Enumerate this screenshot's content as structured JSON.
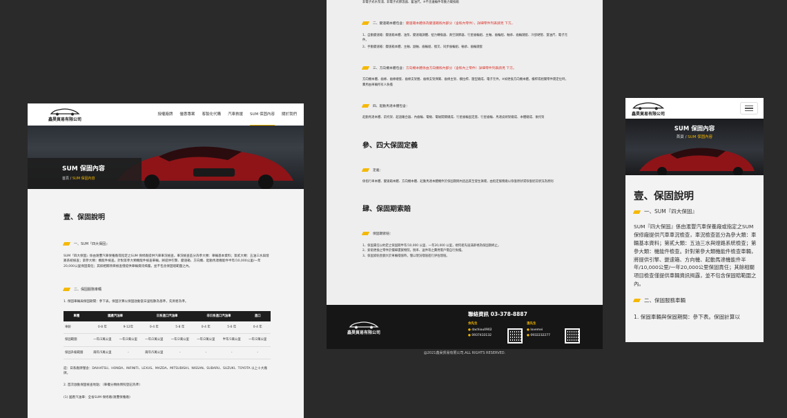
{
  "brand": {
    "logo_text": "鑫昊貿易有限公司"
  },
  "nav": {
    "items": [
      "授權廠牌",
      "優惠專案",
      "客製化代購",
      "汽車救援",
      "SUM 保固內容",
      "關於我們"
    ],
    "active_index": 4
  },
  "hero": {
    "title": "SUM 保固內容",
    "crumb_home": "首頁",
    "crumb_sep": "/",
    "crumb_current": "SUM 保固內容"
  },
  "section1": {
    "title": "壹、保固說明",
    "sub1": "一、SUM『四大保固』",
    "para1": "SUM『四大保固』係由滙豐汽車保養廠或指定之SUM 保修廠提供汽車車況檢查，車況檢查區分為參大類：車輛基本資料；第貳大類：五油三水與燈路系統檢查；第參大類：機能件檢查。針對第參大類機能件檢查車輛，將提供引擎、變速箱、方向機、起動馬達機能件半年/10,000公里/一年20,000公里保固責任；其餘相關項目檢查僅提供車輛資訊揭露，並不包含保固賠範圍之內。",
    "sub2": "二、保固服務車輛",
    "para2": "1. 保固車輛與保固期間：參下表。保固計算以保固啟動當日里程數為基準，先到者為準。"
  },
  "table": {
    "headers": [
      "車種",
      "國產汽油車",
      "日系進口汽油車",
      "非日系進口汽油車",
      "進口"
    ],
    "subheaders": [
      "",
      "",
      "",
      "",
      ""
    ],
    "rows": [
      [
        "車齡",
        "0-8 年",
        "9-12年",
        "0-4 年",
        "5-8 年",
        "0-4 年",
        "5-6 年",
        "0-4 年"
      ],
      [
        "保固範圍",
        "一年/2萬公里",
        "一年/2萬公里",
        "一年/2萬公里",
        "一年/2萬公里",
        "一年/2萬公里",
        "半年/1萬公里",
        "一年/2萬公里"
      ],
      [
        "保固升級範圍",
        "兩年/5萬公里",
        "-",
        "兩年/5萬公里",
        "-",
        "-",
        "-",
        "-"
      ]
    ],
    "note": "註：日系廠牌僅含：DAIHATSU、HONDA、INFINITI、LEXUS、MAZDA、MITSUBISHI、NISSAN、SUBARU、SUZUKI、TOYOTA 以上十大廠牌。",
    "para3": "2. 首次啟動保固檢查地點：（車權分類依牌照登記為準）",
    "para4": "(1) 國產汽油車：全省SUM 保修廠(滙豐保養廠)"
  },
  "middle": {
    "top_line1": "非電子式水泵浦、非電子式節溫器、蓄油尺。※不含邊輪件等動力載換箱",
    "sec2_title": "二、變速箱本體包含：",
    "sec2_red": "變速箱本體係為變速箱殼內部分（含殼內零件），詳細零件列表請見 下方。",
    "sec2_p": "1、自動變速箱：變速箱本體、油泵、變速箱調體、扭力轉換器、真空調節器、行星齒輪組、主軸、齒輪組、軸承、齒輪鏈套、冷卻硬管、蓋油尺、電子元件。",
    "sec2_p2": "2、手動變速箱：變速箱本體、主軸、副軸、齒輪組、撥叉、同步齒輪組、軸承、齒輪鏈套",
    "sec3_title": "三、方向機本體包含：",
    "sec3_red": "方向機本體係由方向機殼內部分（含殼內上零件）詳細零件列表請見 下方。",
    "sec3_p": "方向機本體、齒條、齒條襯套、齒條支架圈、齒條支架彈簧、齒條主架、橫拉桿、壓型總成、電子元件。※如更換方向機本體，橫桿或相關零件需定位時，費用由車輛所有人負擔",
    "sec4_title": "四、起動馬達本體包含：",
    "sec4_p": "起動馬達本體、前托架、超過離合器、內齒輪、電樞、電磁開關總成、行星齒輪固定座、行星齒輪、馬達皮刷架總成、本體總成、後托架",
    "h_def": "參、四大保固定義",
    "def_sub": "定義：",
    "def_p": "係指行車本體、變速箱本體、方向機本體、起動馬達本體機件於保固期間內因品質至發生損壞，由指定服務廠以恢復原狀或恢復從前狀況為原則",
    "h_claim": "肆、保固期索賠",
    "claim_sub": "保固期索賠：",
    "claim_p1": "1、保固責任以約定之保固期半年/10,000 公里、一年20,000 公里，視何者先屆滿即視為保固期終止。",
    "claim_p2": "2、索賠更換之零件於價歸還貿物院，稅率、送件等之費用需戶需自行負擔。",
    "claim_p3": "3、保固索賠金額大於車輛殘值時，僅以現況殘值進行評估理賠。"
  },
  "footer": {
    "contact_title": "聯絡資訊 03-378-8887",
    "c1_name": "余先生",
    "c1_line": "dachiou0902",
    "c1_phone": "0937433132",
    "c2_name": "溫先生",
    "c2_line": "lovemei",
    "c2_phone": "0932232277",
    "copyright": "@2021鑫昊貿易有限公司.ALL RIGHTS RESERVED."
  },
  "mobile": {
    "h1": "壹、保固說明",
    "sub1": "一、SUM『四大保固』",
    "para1": "SUM『四大保固』係由滙豐汽車保養廠或指定之SUM 保修廠提供汽車車況檢查，車況檢查區分為參大類：車輛基本資料；第貳大類：五油三水與燈路系統檢查；第參大類：機能件檢查。針對第參大類機能件檢查車輛，將提供引擎、變速箱、方向機、起動馬達機能件半年/10,000公里/一年20,000公里保固責任；其餘相關項目檢查僅提供車輛資訊揭露，並不包含保固賠範圍之內。",
    "sub2": "二、保固服務車輛",
    "para2": "1. 保固車輛與保固期間：參下表。保固計算以"
  },
  "colors": {
    "accent": "#f5b800",
    "dark": "#161616",
    "red": "#d9342b"
  }
}
